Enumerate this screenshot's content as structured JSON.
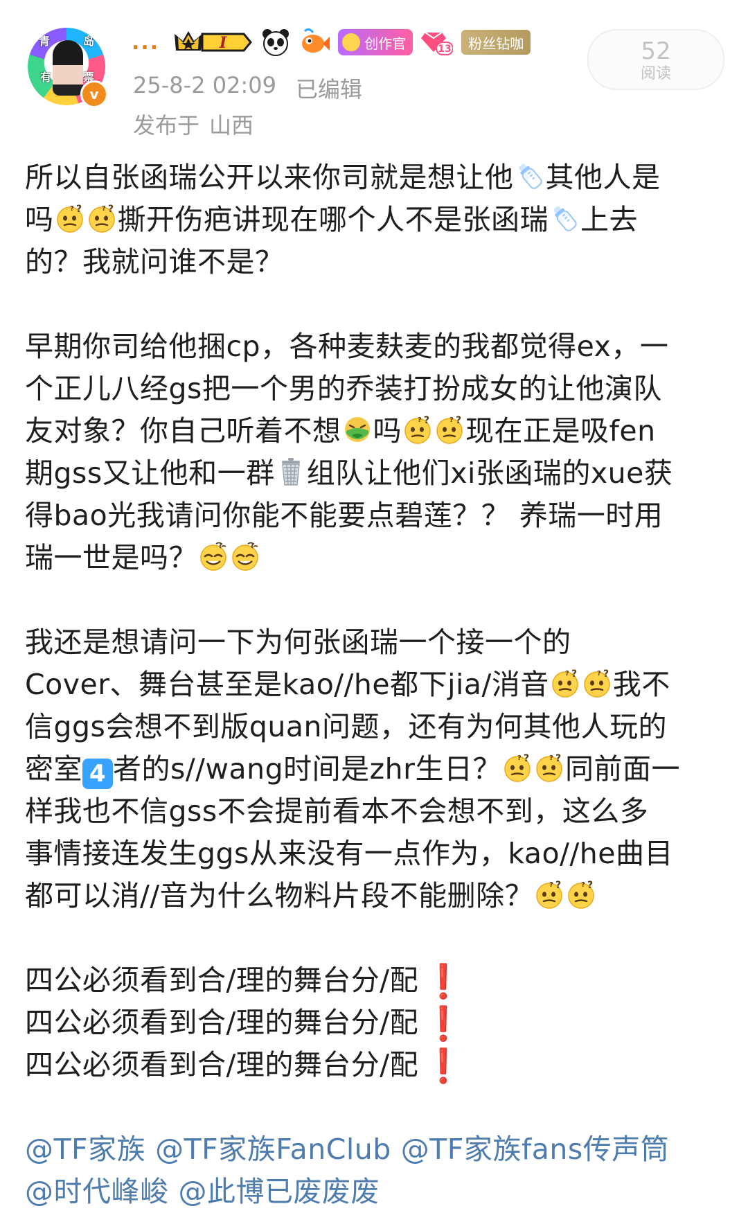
{
  "header": {
    "avatar_labels": [
      "青",
      "岛",
      "有",
      "票"
    ],
    "username": "...",
    "vip_level": "I",
    "creator_badge": "创作官",
    "gem_level": "13",
    "fan_badge": "粉丝钻咖",
    "timestamp": "25-8-2 02:09",
    "edited": "已编辑",
    "location_prefix": "发布于",
    "location": "山西",
    "read_count": "52",
    "read_label": "阅读"
  },
  "post": {
    "p1": {
      "l1": "所以自张函瑞公开以来你司就是想让他",
      "l1b": "其他人是",
      "l2a": "吗",
      "l2b": "撕开伤疤讲现在哪个人不是张函瑞",
      "l2c": "上去",
      "l3": "的？我就问谁不是？"
    },
    "p2": {
      "l1": "早期你司给他捆cp，各种麦麸麦的我都觉得ex，一",
      "l2": "个正儿八经gs把一个男的乔装打扮成女的让他演队",
      "l3a": "友对象？你自己听着不想",
      "l3b": "吗",
      "l3c": "现在正是吸fen",
      "l4a": "期gss又让他和一群",
      "l4b": "组队让他们xi张函瑞的xue获",
      "l5": "得bao光我请问你能不能要点碧莲？？ 养瑞一时用",
      "l6": "瑞一世是吗？"
    },
    "p3": {
      "l1": "我还是想请问一下为何张函瑞一个接一个的",
      "l2a": "Cover、舞台甚至是kao//he都下jia/消音",
      "l2b": "我不",
      "l3": "信ggs会想不到版quan问题，还有为何其他人玩的",
      "l4a": "密室",
      "l4_key": "4",
      "l4b": "者的s//wang时间是zhr生日？",
      "l4c": "同前面一",
      "l5": "样我也不信gss不会提前看本不会想不到，这么多",
      "l6": "事情接连发生ggs从来没有一点作为，kao//he曲目",
      "l7": "都可以消//音为什么物料片段不能删除？"
    },
    "demands": [
      "四公必须看到合/理的舞台分/配",
      "四公必须看到合/理的舞台分/配",
      "四公必须看到合/理的舞台分/配"
    ],
    "bang": "❗",
    "mentions_line1": [
      "@TF家族",
      "@TF家族FanClub",
      "@TF家族fans传声筒"
    ],
    "mentions_line2": [
      "@时代峰峻",
      "@此博已废废废"
    ]
  },
  "colors": {
    "username": "#e57a1b",
    "meta_text": "#9a9a9a",
    "mention": "#4f7cae",
    "body_text": "#1e1e1e",
    "alert_red": "#e63b3b"
  },
  "icons": {
    "bottle": "baby-bottle-emoji",
    "thinking": "doubtful-face-emoji",
    "vomit": "vomiting-face-emoji",
    "trash": "trash-can-emoji",
    "dizzy": "dizzy-face-emoji",
    "keycap": "keycap-4-emoji"
  }
}
